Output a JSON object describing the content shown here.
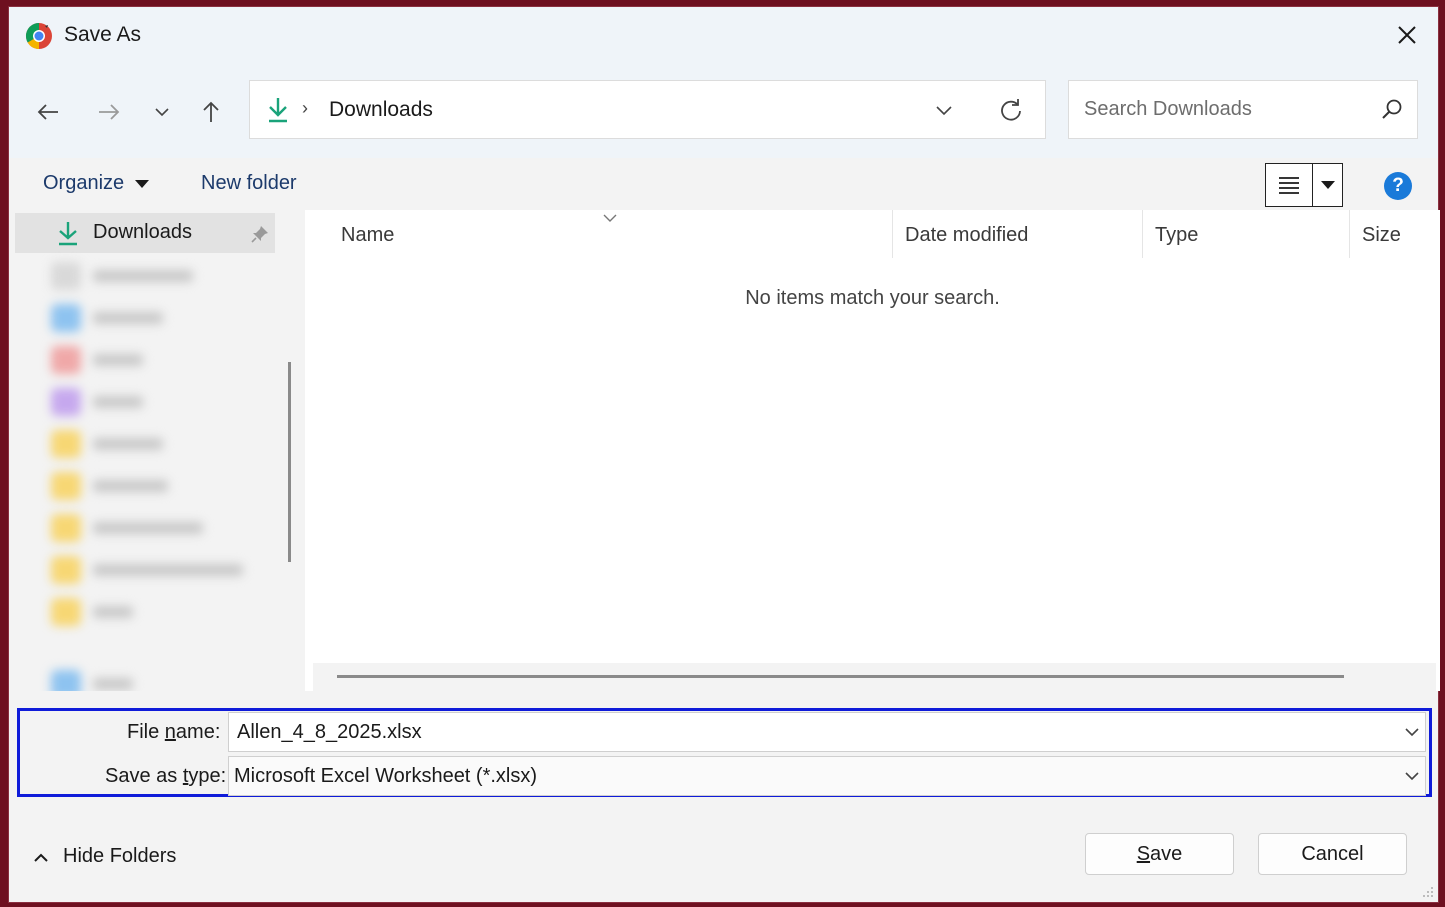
{
  "window": {
    "title": "Save As"
  },
  "address": {
    "location": "Downloads",
    "separator": "›"
  },
  "search": {
    "placeholder": "Search Downloads"
  },
  "toolbar": {
    "organize_label": "Organize",
    "new_folder_label": "New folder"
  },
  "navpane": {
    "active_item": "Downloads"
  },
  "columns": {
    "name": "Name",
    "date_modified": "Date modified",
    "type": "Type",
    "size": "Size"
  },
  "filepane": {
    "empty_message": "No items match your search."
  },
  "fields": {
    "file_name_label_pre": "File ",
    "file_name_label_ul": "n",
    "file_name_label_post": "ame:",
    "file_name_value": "Allen_4_8_2025.xlsx",
    "save_type_label_pre": "Save as ",
    "save_type_label_ul": "t",
    "save_type_label_post": "ype:",
    "save_type_value": "Microsoft Excel Worksheet (*.xlsx)"
  },
  "footer": {
    "hide_folders_label": "Hide Folders",
    "save_label_ul": "S",
    "save_label_rest": "ave",
    "cancel_label": "Cancel"
  },
  "colors": {
    "accent": "#0f1bd9",
    "download_icon": "#1aa37a",
    "help": "#1a7ad9"
  }
}
